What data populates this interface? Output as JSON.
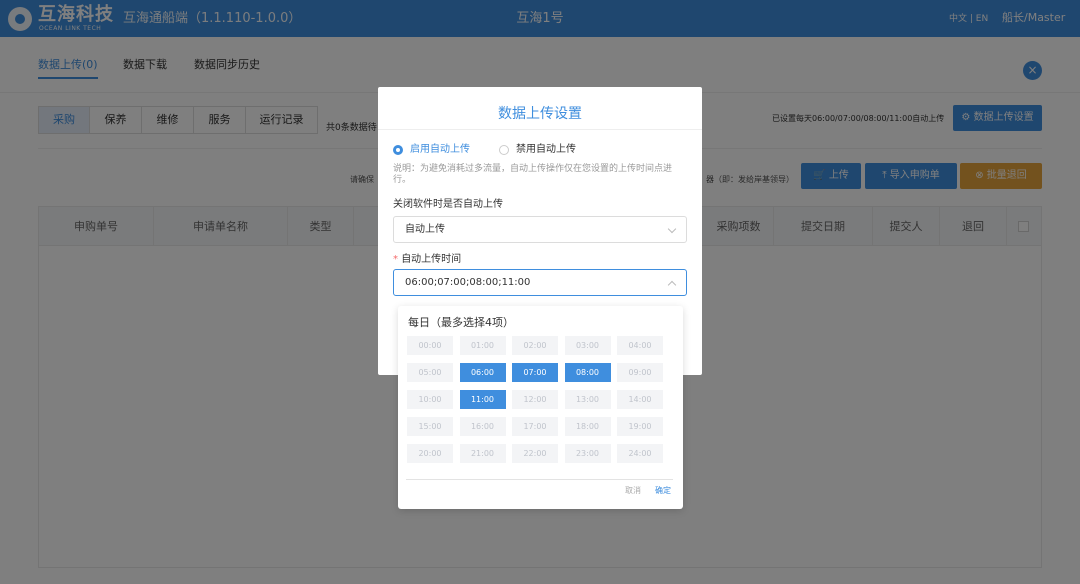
{
  "header": {
    "brand": "互海科技",
    "brand_sub": "OCEAN LINK TECH",
    "app_name": "互海通船端（1.1.110-1.0.0）",
    "ship_name": "互海1号",
    "language": "中文 | EN",
    "user": "船长/Master"
  },
  "main_tabs": [
    {
      "label": "数据上传(0)",
      "active": true
    },
    {
      "label": "数据下载",
      "active": false
    },
    {
      "label": "数据同步历史",
      "active": false
    }
  ],
  "sub_tabs": [
    {
      "label": "采购",
      "active": true
    },
    {
      "label": "保养",
      "active": false
    },
    {
      "label": "维修",
      "active": false
    },
    {
      "label": "服务",
      "active": false
    },
    {
      "label": "运行记录",
      "active": false
    }
  ],
  "pending_count_text": "共0条数据待",
  "auto_upload_note": "已设置每天06:00/07:00/08:00/11:00自动上传",
  "buttons": {
    "upload_settings": "数据上传设置",
    "upload": "上传",
    "import_purchase": "导入申购单",
    "batch_return": "批量退回"
  },
  "hint_left": "请确保",
  "hint_right": "器（即：发给岸基领导）",
  "table_headers": [
    "申购单号",
    "申请单名称",
    "类型",
    "采购项数",
    "提交日期",
    "提交人",
    "退回"
  ],
  "modal": {
    "title": "数据上传设置",
    "radio_enable": "启用自动上传",
    "radio_disable": "禁用自动上传",
    "note": "说明：为避免消耗过多流量，自动上传操作仅在您设置的上传时间点进行。",
    "close_label": "关闭软件时是否自动上传",
    "close_value": "自动上传",
    "time_label": "自动上传时间",
    "time_value": "06:00;07:00;08:00;11:00"
  },
  "time_picker": {
    "title": "每日（最多选择4项）",
    "times": [
      "00:00",
      "01:00",
      "02:00",
      "03:00",
      "04:00",
      "05:00",
      "06:00",
      "07:00",
      "08:00",
      "09:00",
      "10:00",
      "11:00",
      "12:00",
      "13:00",
      "14:00",
      "15:00",
      "16:00",
      "17:00",
      "18:00",
      "19:00",
      "20:00",
      "21:00",
      "22:00",
      "23:00",
      "24:00"
    ],
    "selected": [
      "06:00",
      "07:00",
      "08:00",
      "11:00"
    ],
    "cancel": "取消",
    "confirm": "确定"
  },
  "colors": {
    "primary": "#3f8ede",
    "warning": "#e7a53c"
  }
}
